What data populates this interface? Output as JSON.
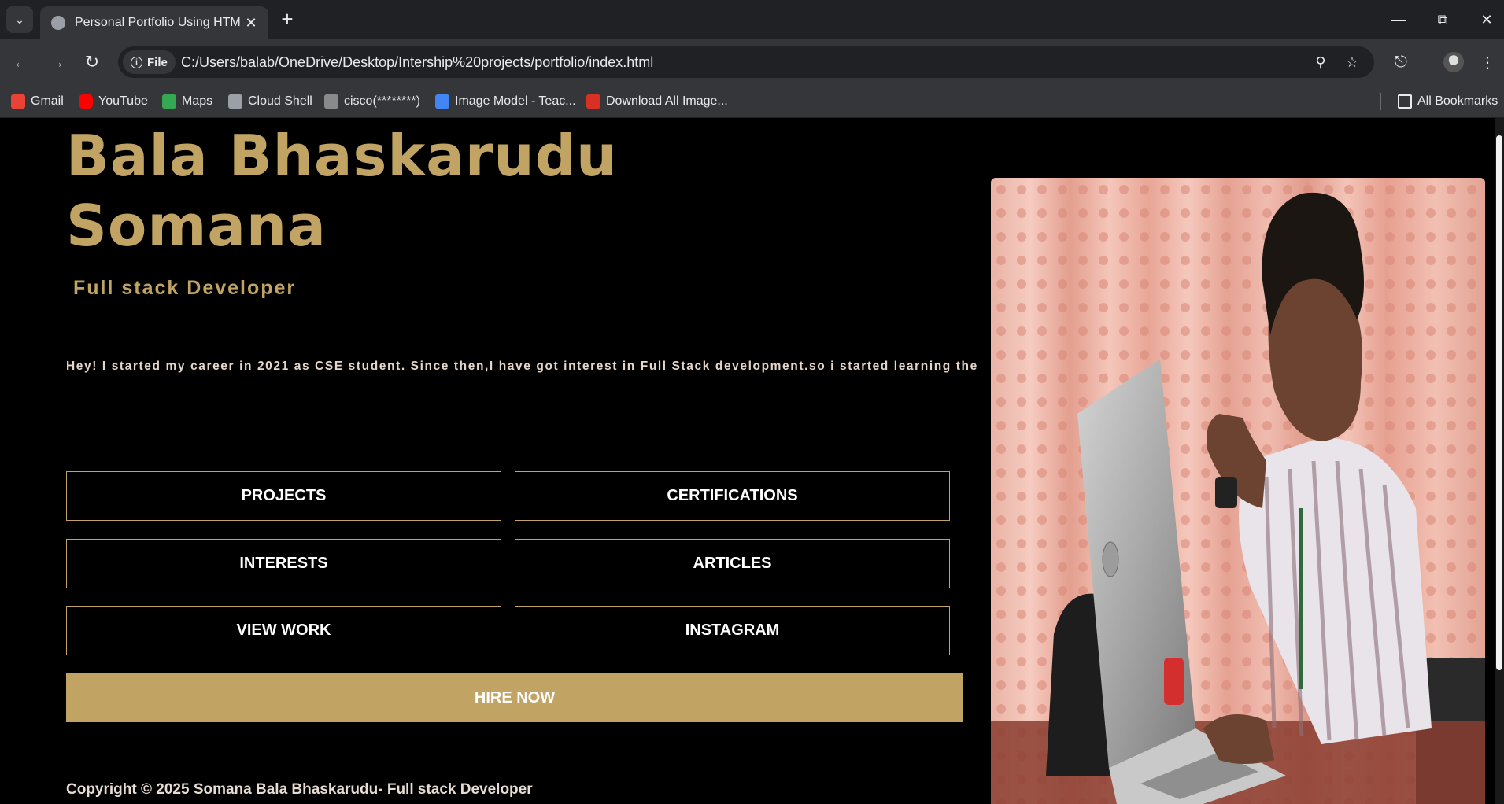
{
  "browser": {
    "tab_title": "Personal Portfolio Using HTML & CSS",
    "file_label": "File",
    "url": "C:/Users/balab/OneDrive/Desktop/Intership%20projects/portfolio/index.html",
    "bookmarks": [
      {
        "label": "Gmail",
        "icon": "gmail-icon",
        "color": "#ea4335"
      },
      {
        "label": "YouTube",
        "icon": "youtube-icon",
        "color": "#ff0000"
      },
      {
        "label": "Maps",
        "icon": "maps-icon",
        "color": "#34a853"
      },
      {
        "label": "Cloud Shell",
        "icon": "cloud-shell-icon",
        "color": "#9aa0a6"
      },
      {
        "label": "cisco(********)",
        "icon": "cisco-icon",
        "color": "#8a8a8a"
      },
      {
        "label": "Image Model - Teac...",
        "icon": "teachable-machine-icon",
        "color": "#4285f4"
      },
      {
        "label": "Download All Image...",
        "icon": "download-images-icon",
        "color": "#d93025"
      }
    ],
    "all_bookmarks_label": "All Bookmarks"
  },
  "page": {
    "name_line1": "Bala Bhaskarudu",
    "name_line2": "Somana",
    "role": "Full stack Developer",
    "bio": "Hey! I started my career in 2021 as CSE student. Since then,I have got interest in Full Stack development.so i started learning the",
    "buttons": [
      "PROJECTS",
      "CERTIFICATIONS",
      "INTERESTS",
      "ARTICLES",
      "VIEW WORK",
      "INSTAGRAM"
    ],
    "hire_label": "HIRE NOW",
    "copyright": "Copyright © 2025 Somana Bala Bhaskarudu- Full stack Developer"
  },
  "colors": {
    "accent": "#c1a363",
    "background": "#000000",
    "chrome_dark": "#202124",
    "chrome": "#35363a"
  }
}
